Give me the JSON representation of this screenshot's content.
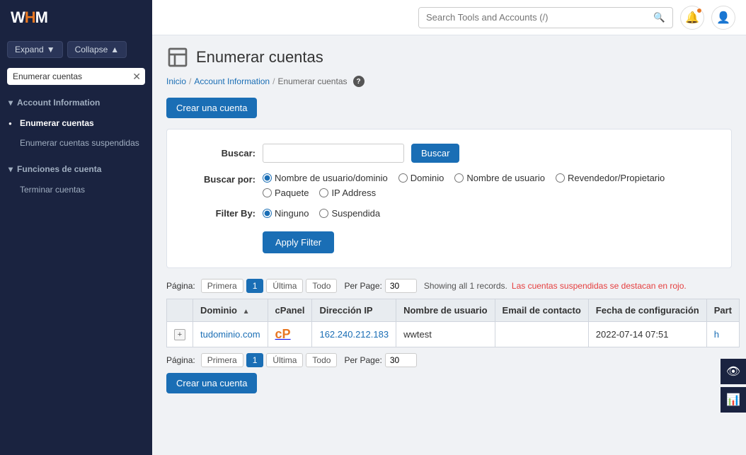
{
  "sidebar": {
    "logo": "WHM",
    "logo_accent": "M",
    "expand_label": "Expand",
    "collapse_label": "Collapse",
    "search_placeholder": "Enumerar cuentas",
    "sections": [
      {
        "id": "account-information",
        "label": "Account Information",
        "expanded": true,
        "items": [
          {
            "id": "enumerar-cuentas",
            "label": "Enumerar cuentas",
            "active": true
          },
          {
            "id": "enumerar-cuentas-suspendidas",
            "label": "Enumerar cuentas\nsuspendidas",
            "active": false
          }
        ]
      },
      {
        "id": "funciones-de-cuenta",
        "label": "Funciones de cuenta",
        "expanded": true,
        "items": [
          {
            "id": "terminar-cuentas",
            "label": "Terminar cuentas",
            "active": false
          }
        ]
      }
    ]
  },
  "topbar": {
    "search_placeholder": "Search Tools and Accounts (/)"
  },
  "page": {
    "title": "Enumerar cuentas",
    "breadcrumb": {
      "inicio": "Inicio",
      "account_information": "Account Information",
      "current": "Enumerar cuentas"
    },
    "create_btn": "Crear una cuenta",
    "filter": {
      "buscar_label": "Buscar:",
      "buscar_btn": "Buscar",
      "buscar_por_label": "Buscar por:",
      "radio_options_1": [
        {
          "id": "nombre-usuario-dominio",
          "label": "Nombre de usuario/dominio",
          "checked": true
        },
        {
          "id": "dominio",
          "label": "Dominio",
          "checked": false
        },
        {
          "id": "nombre-usuario",
          "label": "Nombre de usuario",
          "checked": false
        },
        {
          "id": "revendedor-propietario",
          "label": "Revendedor/Propietario",
          "checked": false
        }
      ],
      "radio_options_2": [
        {
          "id": "paquete",
          "label": "Paquete",
          "checked": false
        },
        {
          "id": "ip-address",
          "label": "IP Address",
          "checked": false
        }
      ],
      "filter_by_label": "Filter By:",
      "filter_radio": [
        {
          "id": "ninguno",
          "label": "Ninguno",
          "checked": true
        },
        {
          "id": "suspendida",
          "label": "Suspendida",
          "checked": false
        }
      ],
      "apply_btn": "Apply Filter"
    },
    "pagination_top": {
      "pagina_label": "Página:",
      "primera": "Primera",
      "page_num": "1",
      "ultima": "Última",
      "todo": "Todo",
      "per_page_label": "Per Page:",
      "per_page_val": "30",
      "records_info": "Showing all 1 records.",
      "suspended_info": "Las cuentas suspendidas se destacan en rojo."
    },
    "table": {
      "headers": [
        "",
        "Dominio",
        "cPanel",
        "Dirección IP",
        "Nombre de usuario",
        "Email de contacto",
        "Fecha de configuración",
        "Part"
      ],
      "rows": [
        {
          "expand": "+",
          "dominio": "tudominio.com",
          "cpanel": "cP",
          "ip": "162.240.212.183",
          "usuario": "wwtest",
          "email": "",
          "fecha": "2022-07-14 07:51",
          "part": "h"
        }
      ]
    },
    "pagination_bottom": {
      "pagina_label": "Página:",
      "primera": "Primera",
      "page_num": "1",
      "ultima": "Última",
      "todo": "Todo",
      "per_page_label": "Per Page:",
      "per_page_val": "30"
    },
    "create_btn_bottom": "Crear una cuenta"
  }
}
